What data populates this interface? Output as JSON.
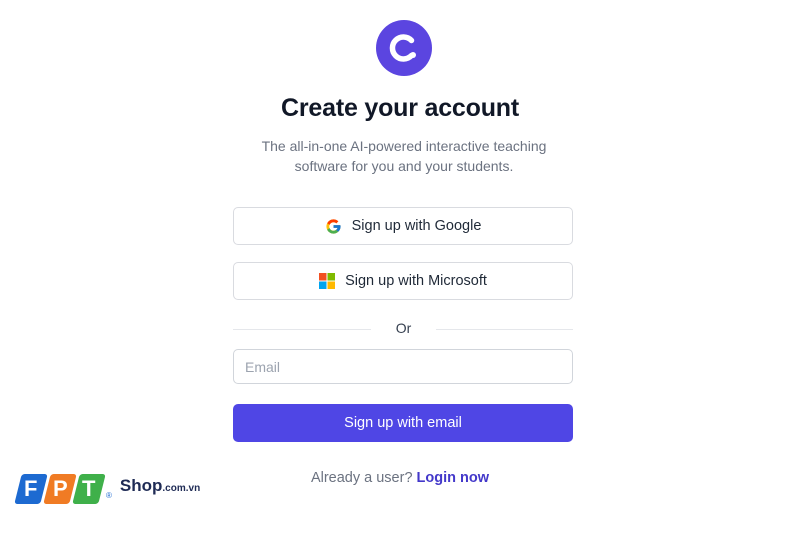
{
  "header": {
    "logo_icon": "classpoint-c-logo",
    "title": "Create your account",
    "subtitle": "The all-in-one AI-powered interactive teaching software for you and your students."
  },
  "oauth": {
    "google_label": "Sign up with Google",
    "google_icon": "google-icon",
    "microsoft_label": "Sign up with Microsoft",
    "microsoft_icon": "microsoft-icon"
  },
  "divider": {
    "label": "Or"
  },
  "email_form": {
    "value": "",
    "placeholder": "Email",
    "submit_label": "Sign up with email"
  },
  "footer": {
    "prompt": "Already a user?",
    "login_label": "Login now"
  },
  "watermark": {
    "letters": [
      "F",
      "P",
      "T"
    ],
    "registered": "®",
    "shop": "Shop",
    "domain": ".com.vn"
  },
  "colors": {
    "brand_purple": "#5b45e0",
    "primary_button": "#4f46e5",
    "link": "#4338ca",
    "fpt_blue": "#1d6ad1",
    "fpt_orange": "#f07b24",
    "fpt_green": "#3fb04a"
  }
}
